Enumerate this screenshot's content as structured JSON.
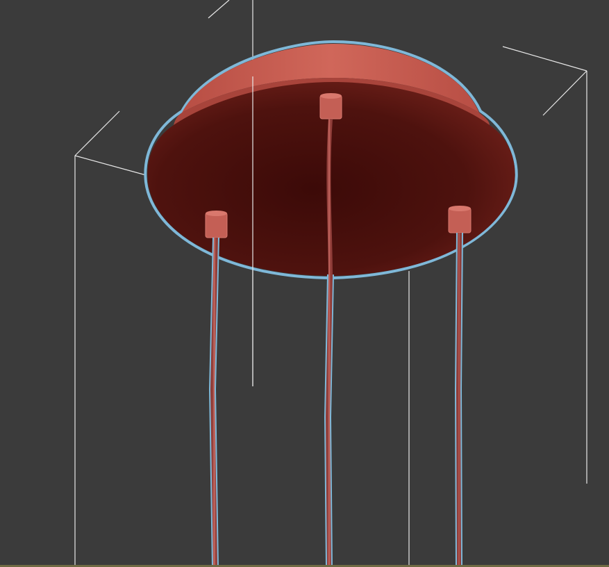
{
  "viewport": {
    "name": "3d-perspective-viewport",
    "background": "#3b3b3b"
  },
  "object": {
    "name": "pendant-lamp-canopy-with-three-cords",
    "cord_count": 3,
    "selected": true,
    "colors": {
      "canopy_top": "#c85a4c",
      "canopy_rim": "#b04a40",
      "canopy_bottom": "#4a0f0c",
      "cord": "#b85550",
      "selection_outline": "#7fb8d8"
    }
  },
  "selection_bracket": {
    "color": "#e8e8e8"
  },
  "grid_ground_color": "#6f6a43"
}
